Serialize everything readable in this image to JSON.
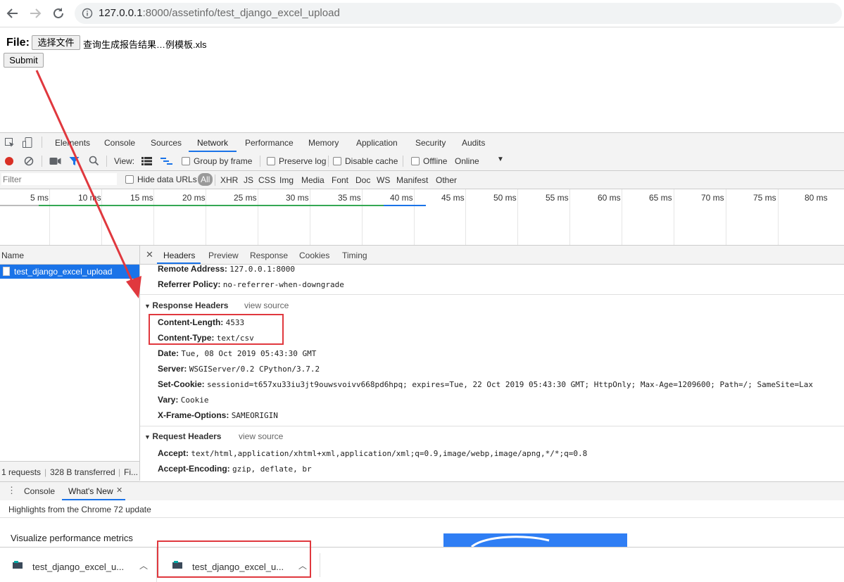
{
  "browser": {
    "url_host": "127.0.0.1",
    "url_path": ":8000/assetinfo/test_django_excel_upload"
  },
  "page": {
    "file_label": "File:",
    "choose_file_button": "选择文件",
    "file_name": "查询生成报告结果…例模板.xls",
    "submit_button": "Submit"
  },
  "devtools": {
    "tabs": [
      "Elements",
      "Console",
      "Sources",
      "Network",
      "Performance",
      "Memory",
      "Application",
      "Security",
      "Audits"
    ],
    "toolbar": {
      "view_label": "View:",
      "group_by_frame": "Group by frame",
      "preserve_log": "Preserve log",
      "disable_cache": "Disable cache",
      "offline": "Offline",
      "online": "Online"
    },
    "filter": {
      "placeholder": "Filter",
      "hide_data_urls": "Hide data URLs",
      "types": [
        "All",
        "XHR",
        "JS",
        "CSS",
        "Img",
        "Media",
        "Font",
        "Doc",
        "WS",
        "Manifest",
        "Other"
      ]
    },
    "timeline_labels": [
      "5 ms",
      "10 ms",
      "15 ms",
      "20 ms",
      "25 ms",
      "30 ms",
      "35 ms",
      "40 ms",
      "45 ms",
      "50 ms",
      "55 ms",
      "60 ms",
      "65 ms",
      "70 ms",
      "75 ms",
      "80 ms"
    ],
    "name_header": "Name",
    "request_name": "test_django_excel_upload",
    "summary": {
      "requests": "1 requests",
      "transferred": "328 B transferred",
      "finish": "Fi..."
    },
    "detail_tabs": [
      "Headers",
      "Preview",
      "Response",
      "Cookies",
      "Timing"
    ],
    "general": [
      {
        "k": "Remote Address:",
        "v": "127.0.0.1:8000"
      },
      {
        "k": "Referrer Policy:",
        "v": "no-referrer-when-downgrade"
      }
    ],
    "response_headers": {
      "title": "Response Headers",
      "view_source": "view source",
      "rows": [
        {
          "k": "Content-Length:",
          "v": "4533"
        },
        {
          "k": "Content-Type:",
          "v": "text/csv"
        },
        {
          "k": "Date:",
          "v": "Tue, 08 Oct 2019 05:43:30 GMT"
        },
        {
          "k": "Server:",
          "v": "WSGIServer/0.2 CPython/3.7.2"
        },
        {
          "k": "Set-Cookie:",
          "v": "sessionid=t657xu33iu3jt9ouwsvoivv668pd6hpq; expires=Tue, 22 Oct 2019 05:43:30 GMT; HttpOnly; Max-Age=1209600; Path=/; SameSite=Lax"
        },
        {
          "k": "Vary:",
          "v": "Cookie"
        },
        {
          "k": "X-Frame-Options:",
          "v": "SAMEORIGIN"
        }
      ]
    },
    "request_headers": {
      "title": "Request Headers",
      "view_source": "view source",
      "rows": [
        {
          "k": "Accept:",
          "v": "text/html,application/xhtml+xml,application/xml;q=0.9,image/webp,image/apng,*/*;q=0.8"
        },
        {
          "k": "Accept-Encoding:",
          "v": "gzip, deflate, br"
        }
      ]
    },
    "drawer": {
      "tabs": [
        "Console",
        "What's New"
      ],
      "highlights": "Highlights from the Chrome 72 update",
      "feature": "Visualize performance metrics"
    }
  },
  "downloads": [
    {
      "name": "test_django_excel_u..."
    },
    {
      "name": "test_django_excel_u..."
    }
  ],
  "colors": {
    "accent": "#1a73e8",
    "annotation_red": "#e0383e",
    "record_red": "#d93025"
  }
}
